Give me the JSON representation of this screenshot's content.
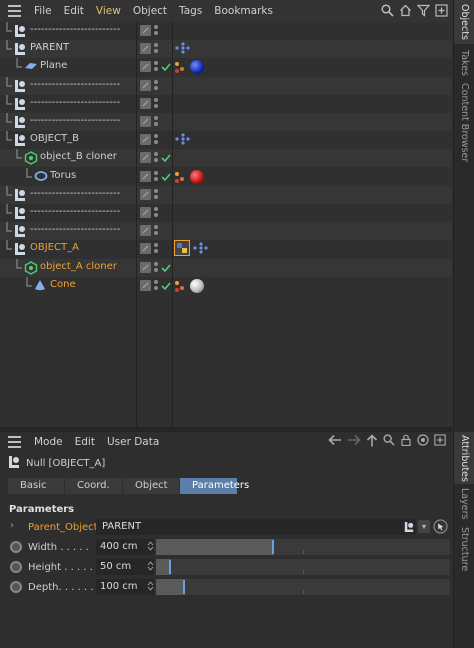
{
  "menubar": {
    "items": [
      "File",
      "Edit",
      "View",
      "Object",
      "Tags",
      "Bookmarks"
    ],
    "active_item": "View",
    "icons": [
      "search-icon",
      "home-icon",
      "filter-icon",
      "new-window-icon"
    ]
  },
  "right_tabs_top": [
    "Objects",
    "Takes",
    "Content Browser"
  ],
  "right_tabs_bottom": [
    "Attributes",
    "Layers",
    "Structure"
  ],
  "objects": [
    {
      "label": "-------------------------",
      "indent": 0,
      "type": "null",
      "color": "normal"
    },
    {
      "label": "PARENT",
      "indent": 0,
      "type": "null",
      "color": "normal",
      "tag": "children-dots"
    },
    {
      "label": "Plane",
      "indent": 1,
      "type": "plane",
      "color": "normal",
      "tag": "material-blue"
    },
    {
      "label": "-------------------------",
      "indent": 0,
      "type": "null",
      "color": "normal"
    },
    {
      "label": "-------------------------",
      "indent": 0,
      "type": "null",
      "color": "normal"
    },
    {
      "label": "-------------------------",
      "indent": 0,
      "type": "null",
      "color": "normal"
    },
    {
      "label": "OBJECT_B",
      "indent": 0,
      "type": "null",
      "color": "normal",
      "tag": "children-dots"
    },
    {
      "label": "object_B cloner",
      "indent": 1,
      "type": "cloner",
      "color": "normal",
      "check": true
    },
    {
      "label": "Torus",
      "indent": 2,
      "type": "torus",
      "color": "normal",
      "tag": "material-red"
    },
    {
      "label": "-------------------------",
      "indent": 0,
      "type": "null",
      "color": "normal"
    },
    {
      "label": "-------------------------",
      "indent": 0,
      "type": "null",
      "color": "normal"
    },
    {
      "label": "-------------------------",
      "indent": 0,
      "type": "null",
      "color": "normal"
    },
    {
      "label": "OBJECT_A",
      "indent": 0,
      "type": "null",
      "color": "orange",
      "tag": "python-children"
    },
    {
      "label": "object_A cloner",
      "indent": 1,
      "type": "cloner",
      "color": "orange",
      "check": true
    },
    {
      "label": "Cone",
      "indent": 2,
      "type": "cone",
      "color": "orange",
      "tag": "material-white"
    }
  ],
  "attributes": {
    "menubar": [
      "Mode",
      "Edit",
      "User Data"
    ],
    "nav_icons": [
      "back-arrow-icon",
      "forward-arrow-icon",
      "up-arrow-icon",
      "search-icon",
      "lock-icon",
      "target-icon",
      "new-window-icon"
    ],
    "object_title": "Null [OBJECT_A]",
    "tabs": [
      "Basic",
      "Coord.",
      "Object",
      "Parameters"
    ],
    "active_tab": "Parameters",
    "section_title": "Parameters",
    "parent_object": {
      "label": "Parent_Object",
      "value": "PARENT"
    },
    "params": [
      {
        "label": "Width . . . . .",
        "value": "400 cm",
        "level": 0.4
      },
      {
        "label": "Height . . . . .",
        "value": "50 cm",
        "level": 0.05
      },
      {
        "label": "Depth. . . . . .",
        "value": "100 cm",
        "level": 0.1
      }
    ]
  }
}
